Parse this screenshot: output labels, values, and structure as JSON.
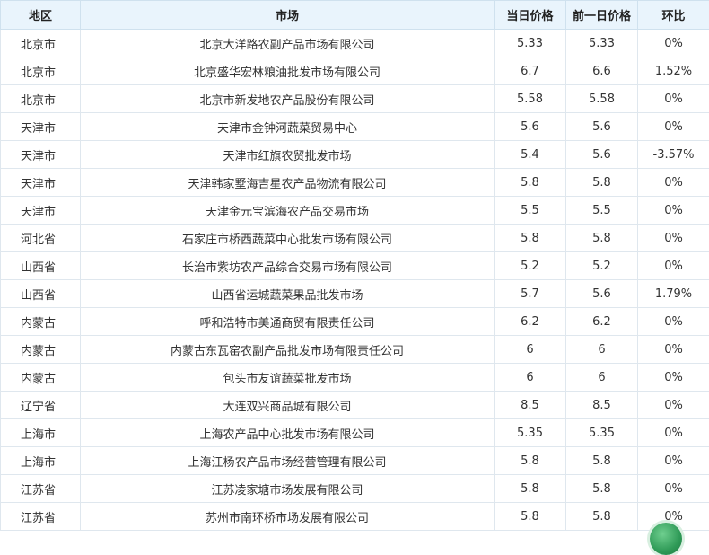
{
  "table": {
    "headers": {
      "region": "地区",
      "market": "市场",
      "today": "当日价格",
      "prev": "前一日价格",
      "change": "环比"
    },
    "rows": [
      {
        "region": "北京市",
        "market": "北京大洋路农副产品市场有限公司",
        "today": "5.33",
        "prev": "5.33",
        "change": "0%"
      },
      {
        "region": "北京市",
        "market": "北京盛华宏林粮油批发市场有限公司",
        "today": "6.7",
        "prev": "6.6",
        "change": "1.52%"
      },
      {
        "region": "北京市",
        "market": "北京市新发地农产品股份有限公司",
        "today": "5.58",
        "prev": "5.58",
        "change": "0%"
      },
      {
        "region": "天津市",
        "market": "天津市金钟河蔬菜贸易中心",
        "today": "5.6",
        "prev": "5.6",
        "change": "0%"
      },
      {
        "region": "天津市",
        "market": "天津市红旗农贸批发市场",
        "today": "5.4",
        "prev": "5.6",
        "change": "-3.57%"
      },
      {
        "region": "天津市",
        "market": "天津韩家墅海吉星农产品物流有限公司",
        "today": "5.8",
        "prev": "5.8",
        "change": "0%"
      },
      {
        "region": "天津市",
        "market": "天津金元宝滨海农产品交易市场",
        "today": "5.5",
        "prev": "5.5",
        "change": "0%"
      },
      {
        "region": "河北省",
        "market": "石家庄市桥西蔬菜中心批发市场有限公司",
        "today": "5.8",
        "prev": "5.8",
        "change": "0%"
      },
      {
        "region": "山西省",
        "market": "长治市紫坊农产品综合交易市场有限公司",
        "today": "5.2",
        "prev": "5.2",
        "change": "0%"
      },
      {
        "region": "山西省",
        "market": "山西省运城蔬菜果品批发市场",
        "today": "5.7",
        "prev": "5.6",
        "change": "1.79%"
      },
      {
        "region": "内蒙古",
        "market": "呼和浩特市美通商贸有限责任公司",
        "today": "6.2",
        "prev": "6.2",
        "change": "0%"
      },
      {
        "region": "内蒙古",
        "market": "内蒙古东瓦窑农副产品批发市场有限责任公司",
        "today": "6",
        "prev": "6",
        "change": "0%"
      },
      {
        "region": "内蒙古",
        "market": "包头市友谊蔬菜批发市场",
        "today": "6",
        "prev": "6",
        "change": "0%"
      },
      {
        "region": "辽宁省",
        "market": "大连双兴商品城有限公司",
        "today": "8.5",
        "prev": "8.5",
        "change": "0%"
      },
      {
        "region": "上海市",
        "market": "上海农产品中心批发市场有限公司",
        "today": "5.35",
        "prev": "5.35",
        "change": "0%"
      },
      {
        "region": "上海市",
        "market": "上海江杨农产品市场经营管理有限公司",
        "today": "5.8",
        "prev": "5.8",
        "change": "0%"
      },
      {
        "region": "江苏省",
        "market": "江苏凌家塘市场发展有限公司",
        "today": "5.8",
        "prev": "5.8",
        "change": "0%"
      },
      {
        "region": "江苏省",
        "market": "苏州市南环桥市场发展有限公司",
        "today": "5.8",
        "prev": "5.8",
        "change": "0%"
      }
    ]
  },
  "colors": {
    "header_bg": "#e9f4fc",
    "border": "#dfe7ee",
    "text": "#333333",
    "badge": "#2f9a57"
  }
}
